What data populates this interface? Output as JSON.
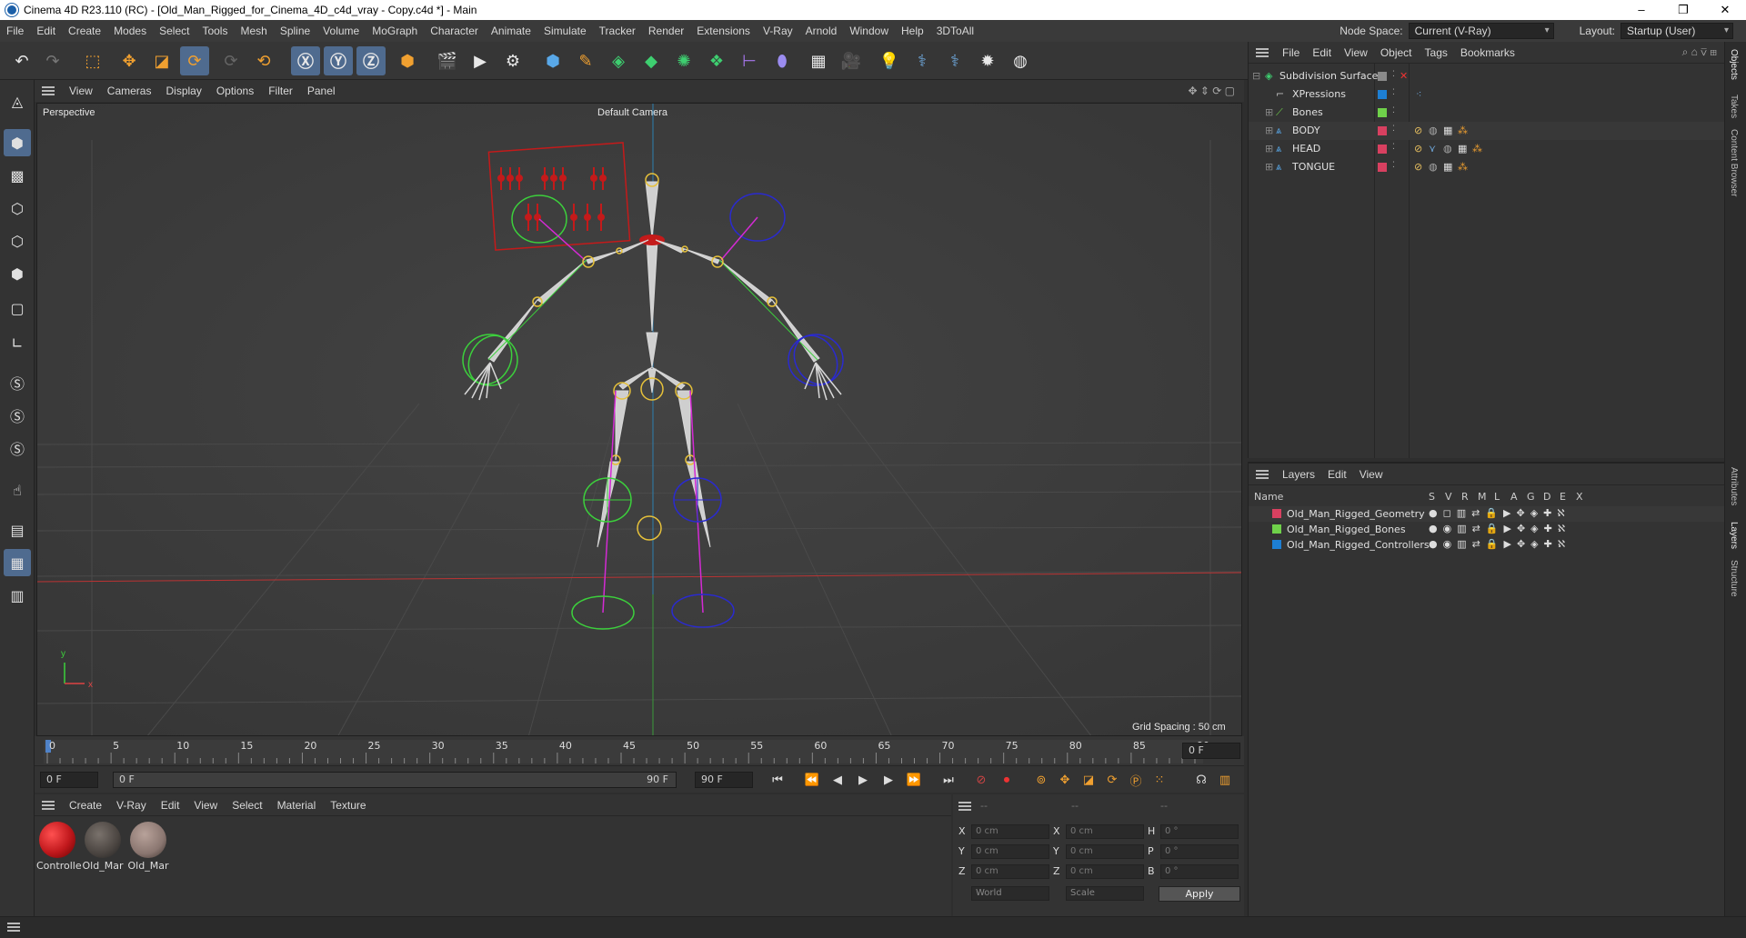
{
  "window": {
    "title": "Cinema 4D R23.110 (RC) - [Old_Man_Rigged_for_Cinema_4D_c4d_vray - Copy.c4d *] - Main",
    "controls": [
      "–",
      "❐",
      "✕"
    ]
  },
  "menubar": {
    "items": [
      "File",
      "Edit",
      "Create",
      "Modes",
      "Select",
      "Tools",
      "Mesh",
      "Spline",
      "Volume",
      "MoGraph",
      "Character",
      "Animate",
      "Simulate",
      "Tracker",
      "Render",
      "Extensions",
      "V-Ray",
      "Arnold",
      "Window",
      "Help",
      "3DToAll"
    ],
    "node_space_label": "Node Space:",
    "node_space_value": "Current (V-Ray)",
    "layout_label": "Layout:",
    "layout_value": "Startup (User)"
  },
  "viewport": {
    "menu": [
      "View",
      "Cameras",
      "Display",
      "Options",
      "Filter",
      "Panel"
    ],
    "view_name": "Perspective",
    "camera": "Default Camera",
    "grid_spacing": "Grid Spacing : 50 cm",
    "axis_y": "y",
    "axis_x": "x"
  },
  "timeline": {
    "ticks": [
      "0",
      "5",
      "10",
      "15",
      "20",
      "25",
      "30",
      "35",
      "40",
      "45",
      "50",
      "55",
      "60",
      "65",
      "70",
      "75",
      "80",
      "85",
      "90"
    ],
    "current_frame_right": "0 F"
  },
  "playbar": {
    "start_field": "0 F",
    "range_start": "0 F",
    "range_end": "90 F",
    "end_field": "90 F"
  },
  "material_manager": {
    "menu": [
      "Create",
      "V-Ray",
      "Edit",
      "View",
      "Select",
      "Material",
      "Texture"
    ],
    "materials": [
      {
        "name": "Controlle",
        "color": "#c0181c"
      },
      {
        "name": "Old_Mar",
        "color": "#5a5450"
      },
      {
        "name": "Old_Mar",
        "color": "#8a7670"
      }
    ]
  },
  "coordinates": {
    "headers": [
      "--",
      "--",
      "--"
    ],
    "rows": [
      {
        "l1": "X",
        "v1": "0 cm",
        "l2": "X",
        "v2": "0 cm",
        "l3": "H",
        "v3": "0 °"
      },
      {
        "l1": "Y",
        "v1": "0 cm",
        "l2": "Y",
        "v2": "0 cm",
        "l3": "P",
        "v3": "0 °"
      },
      {
        "l1": "Z",
        "v1": "0 cm",
        "l2": "Z",
        "v2": "0 cm",
        "l3": "B",
        "v3": "0 °"
      }
    ],
    "mode1": "World",
    "mode2": "Scale",
    "apply": "Apply"
  },
  "object_manager": {
    "menu": [
      "File",
      "Edit",
      "View",
      "Object",
      "Tags",
      "Bookmarks"
    ],
    "objects": [
      {
        "name": "Subdivision Surface",
        "color": "#8a8a8a"
      },
      {
        "name": "XPressions",
        "color": "#1d7fd4"
      },
      {
        "name": "Bones",
        "color": "#6fd14a"
      },
      {
        "name": "BODY",
        "color": "#d84060"
      },
      {
        "name": "HEAD",
        "color": "#d84060"
      },
      {
        "name": "TONGUE",
        "color": "#d84060"
      }
    ]
  },
  "layer_manager": {
    "menu": [
      "Layers",
      "Edit",
      "View"
    ],
    "name_col": "Name",
    "flag_cols": [
      "S",
      "V",
      "R",
      "M",
      "L",
      "A",
      "G",
      "D",
      "E",
      "X"
    ],
    "layers": [
      {
        "name": "Old_Man_Rigged_Geometry",
        "color": "#d84060"
      },
      {
        "name": "Old_Man_Rigged_Bones",
        "color": "#6fd14a"
      },
      {
        "name": "Old_Man_Rigged_Controllers",
        "color": "#1d7fd4"
      }
    ]
  },
  "side_tabs": [
    "Objects",
    "Takes",
    "Content Browser",
    "Attributes",
    "Layers",
    "Structure"
  ]
}
